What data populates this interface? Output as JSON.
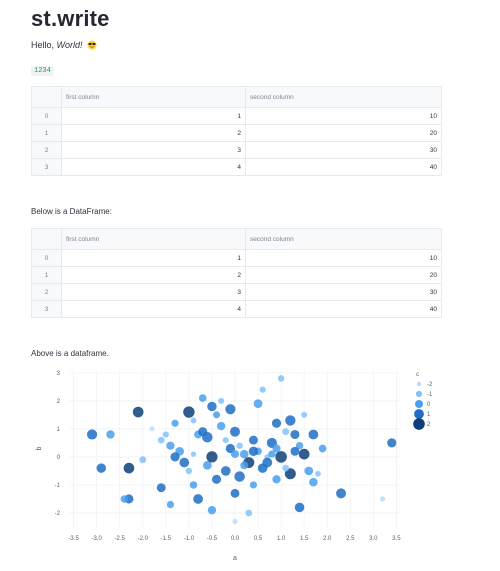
{
  "title": "st.write",
  "hello": {
    "prefix": "Hello, ",
    "emphasis": "World!"
  },
  "code_value": "1234",
  "table1": {
    "columns": [
      "first column",
      "second column"
    ],
    "rows": [
      {
        "index": "0",
        "first": "1",
        "second": "10"
      },
      {
        "index": "1",
        "first": "2",
        "second": "20"
      },
      {
        "index": "2",
        "first": "3",
        "second": "30"
      },
      {
        "index": "3",
        "first": "4",
        "second": "40"
      }
    ]
  },
  "below_text": "Below is a DataFrame:",
  "table2": {
    "columns": [
      "first column",
      "second column"
    ],
    "rows": [
      {
        "index": "0",
        "first": "1",
        "second": "10"
      },
      {
        "index": "1",
        "first": "2",
        "second": "20"
      },
      {
        "index": "2",
        "first": "3",
        "second": "30"
      },
      {
        "index": "3",
        "first": "4",
        "second": "40"
      }
    ]
  },
  "above_text": "Above is a dataframe.",
  "colors": {
    "accent_code": "#09ab3b"
  },
  "chart_data": {
    "type": "scatter",
    "xlabel": "a",
    "ylabel": "b",
    "xlim": [
      -3.6,
      3.6
    ],
    "ylim": [
      -2.5,
      3.1
    ],
    "x_ticks": [
      "-3.5",
      "-3.0",
      "-2.5",
      "-2.0",
      "-1.5",
      "-1.0",
      "-0.5",
      "0.0",
      "0.5",
      "1.0",
      "1.5",
      "2.0",
      "2.5",
      "3.0",
      "3.5"
    ],
    "y_ticks": [
      "3",
      "2",
      "1",
      "0",
      "-1",
      "-2"
    ],
    "legend": {
      "title": "c",
      "placement": "right",
      "labels": [
        "-2",
        "-1",
        "0",
        "1",
        "2"
      ]
    },
    "points": [
      [
        -3.1,
        0.8,
        1.2
      ],
      [
        -2.7,
        0.8,
        0.2
      ],
      [
        -2.9,
        -0.4,
        0.8
      ],
      [
        -2.3,
        -0.4,
        1.5
      ],
      [
        -2.3,
        -1.5,
        0.6
      ],
      [
        -2.4,
        -1.5,
        -0.3
      ],
      [
        -2.1,
        1.6,
        1.5
      ],
      [
        -1.8,
        1.0,
        -1.8
      ],
      [
        -1.6,
        0.6,
        -0.7
      ],
      [
        -1.5,
        0.8,
        -1.0
      ],
      [
        -1.4,
        0.4,
        0.1
      ],
      [
        -1.3,
        1.2,
        -0.4
      ],
      [
        -1.2,
        0.2,
        0.4
      ],
      [
        -1.1,
        -0.2,
        0.9
      ],
      [
        -1.0,
        1.6,
        1.9
      ],
      [
        -0.9,
        1.3,
        -1.2
      ],
      [
        -0.8,
        0.8,
        0.0
      ],
      [
        -0.7,
        0.9,
        0.6
      ],
      [
        -0.6,
        0.7,
        1.4
      ],
      [
        -0.5,
        1.8,
        0.8
      ],
      [
        -0.4,
        1.5,
        -0.5
      ],
      [
        -0.3,
        1.1,
        0.2
      ],
      [
        -0.2,
        0.6,
        -1.1
      ],
      [
        -0.1,
        0.3,
        0.7
      ],
      [
        0.0,
        0.9,
        1.1
      ],
      [
        0.1,
        0.4,
        -0.9
      ],
      [
        0.2,
        0.1,
        0.3
      ],
      [
        0.3,
        -0.2,
        1.6
      ],
      [
        0.4,
        0.6,
        0.5
      ],
      [
        0.5,
        0.2,
        -0.2
      ],
      [
        0.6,
        -0.4,
        0.9
      ],
      [
        0.7,
        0.0,
        -1.4
      ],
      [
        0.8,
        0.5,
        1.2
      ],
      [
        0.9,
        0.3,
        0.1
      ],
      [
        1.0,
        0.0,
        2.2
      ],
      [
        1.1,
        0.9,
        -0.6
      ],
      [
        1.2,
        1.3,
        1.3
      ],
      [
        1.3,
        0.8,
        0.6
      ],
      [
        1.4,
        0.4,
        -0.3
      ],
      [
        1.5,
        0.1,
        1.5
      ],
      [
        1.6,
        -0.5,
        0.4
      ],
      [
        1.7,
        0.8,
        1.0
      ],
      [
        1.8,
        -0.6,
        -1.3
      ],
      [
        1.7,
        -0.9,
        0.3
      ],
      [
        1.0,
        2.8,
        -0.8
      ],
      [
        0.6,
        2.4,
        -1.0
      ],
      [
        3.4,
        0.5,
        0.7
      ],
      [
        3.2,
        -1.5,
        -1.6
      ],
      [
        1.4,
        -1.8,
        0.9
      ],
      [
        0.3,
        -2.0,
        -0.7
      ],
      [
        0.0,
        -2.3,
        -1.6
      ],
      [
        -0.5,
        -1.9,
        0.2
      ],
      [
        -0.8,
        -1.5,
        1.0
      ],
      [
        -1.4,
        -1.7,
        -0.4
      ],
      [
        -1.6,
        -1.1,
        0.5
      ],
      [
        -0.9,
        -1.0,
        -0.3
      ],
      [
        -0.4,
        -0.8,
        0.6
      ],
      [
        0.1,
        -0.7,
        1.4
      ],
      [
        0.4,
        -1.0,
        -0.5
      ],
      [
        0.9,
        -0.8,
        0.2
      ],
      [
        1.2,
        -0.6,
        1.7
      ],
      [
        -1.0,
        -0.5,
        -0.9
      ],
      [
        -0.6,
        -0.3,
        0.4
      ],
      [
        -0.2,
        -0.5,
        0.9
      ],
      [
        0.2,
        -0.3,
        -0.1
      ],
      [
        0.7,
        -0.2,
        1.0
      ],
      [
        1.1,
        -0.4,
        -0.7
      ],
      [
        -1.3,
        0.0,
        0.7
      ],
      [
        -0.9,
        0.1,
        -1.5
      ],
      [
        -0.5,
        0.0,
        1.8
      ],
      [
        0.0,
        0.1,
        0.0
      ],
      [
        0.4,
        0.2,
        0.8
      ],
      [
        0.8,
        0.1,
        -0.4
      ],
      [
        1.3,
        0.2,
        0.5
      ],
      [
        -0.3,
        2.0,
        -1.1
      ],
      [
        -0.7,
        2.1,
        -0.2
      ],
      [
        0.5,
        1.9,
        0.4
      ],
      [
        -0.1,
        1.7,
        1.2
      ],
      [
        1.5,
        1.5,
        -1.2
      ],
      [
        0.9,
        1.2,
        0.7
      ],
      [
        -2.0,
        -0.1,
        -0.6
      ],
      [
        2.3,
        -1.3,
        1.1
      ],
      [
        1.9,
        0.3,
        -0.2
      ],
      [
        0.0,
        -1.3,
        0.5
      ]
    ]
  }
}
